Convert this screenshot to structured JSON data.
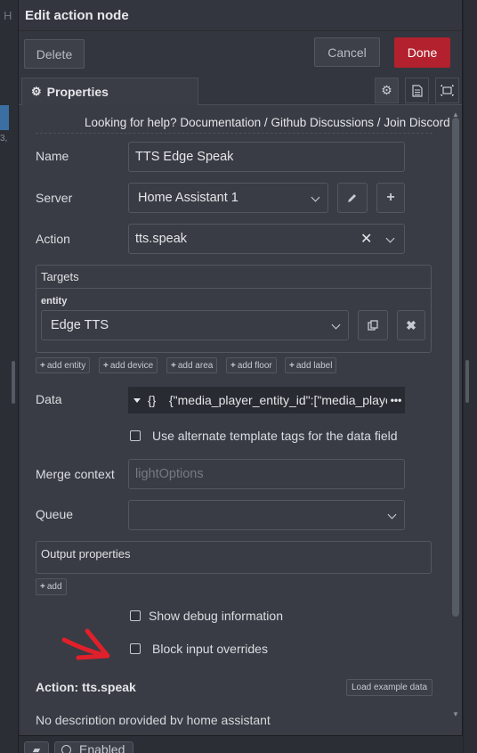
{
  "background": {
    "left_char": "H",
    "left_num": "3,"
  },
  "dialog": {
    "title": "Edit action node",
    "buttons": {
      "delete": "Delete",
      "cancel": "Cancel",
      "done": "Done"
    },
    "tabs": [
      {
        "label": "Properties",
        "icon": "gear-icon"
      }
    ],
    "tab_icons": [
      "gear-icon",
      "document-icon",
      "layout-frame-icon"
    ]
  },
  "help": {
    "prefix": "Looking for help?",
    "links": [
      "Documentation",
      "Github Discussions",
      "Join Discord"
    ],
    "sep": "/"
  },
  "form": {
    "name": {
      "label": "Name",
      "value": "TTS Edge Speak"
    },
    "server": {
      "label": "Server",
      "value": "Home Assistant 1",
      "edit_icon": "pencil-icon",
      "add_icon": "plus-icon"
    },
    "action": {
      "label": "Action",
      "value": "tts.speak"
    },
    "targets": {
      "title": "Targets",
      "entity_label": "entity",
      "entity_value": "Edge TTS",
      "add_buttons": [
        "add entity",
        "add device",
        "add area",
        "add floor",
        "add label"
      ]
    },
    "data": {
      "label": "Data",
      "type_icon": "{}",
      "value": "{\"media_player_entity_id\":[\"media_player"
    },
    "alt_template": {
      "label": "Use alternate template tags for the data field",
      "checked": false
    },
    "merge_context": {
      "label": "Merge context",
      "placeholder": "lightOptions"
    },
    "queue": {
      "label": "Queue",
      "value": ""
    },
    "output_properties": {
      "title": "Output properties",
      "add_label": "add"
    },
    "show_debug": {
      "label": "Show debug information",
      "checked": false
    },
    "block_input": {
      "label": "Block input overrides",
      "checked": false
    }
  },
  "action_info": {
    "title": "Action: tts.speak",
    "load_example": "Load example data",
    "description": "No description provided by home assistant"
  },
  "bottom": {
    "enabled_label": "Enabled"
  },
  "colors": {
    "done": "#b3212e",
    "annotation_arrow": "#e0202a"
  }
}
